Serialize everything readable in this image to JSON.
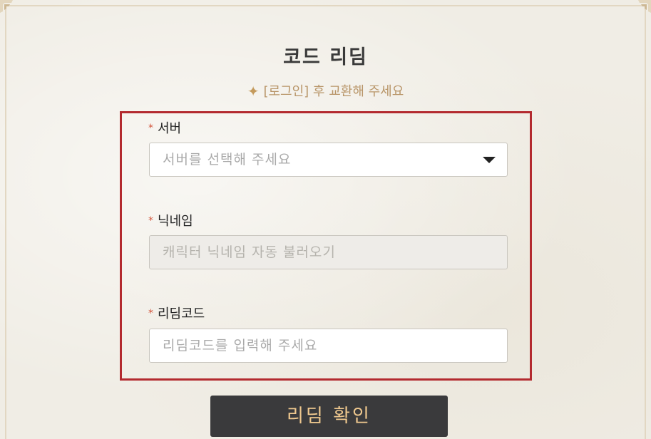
{
  "title": "코드 리딤",
  "notice": {
    "star_icon": "sparkle-icon",
    "text": "[로그인] 후 교환해 주세요"
  },
  "required_mark": "*",
  "fields": {
    "server": {
      "label": "서버",
      "placeholder": "서버를 선택해 주세요",
      "icon": "caret-down-icon"
    },
    "nickname": {
      "label": "닉네임",
      "placeholder": "캐릭터 닉네임 자동 불러오기"
    },
    "code": {
      "label": "리딤코드",
      "placeholder": "리딤코드를 입력해 주세요"
    }
  },
  "submit_label": "리딤 확인",
  "colors": {
    "accent": "#b32a2f",
    "button_bg": "#3a3a3c",
    "button_text": "#f0c98f",
    "notice_text": "#b89568"
  }
}
